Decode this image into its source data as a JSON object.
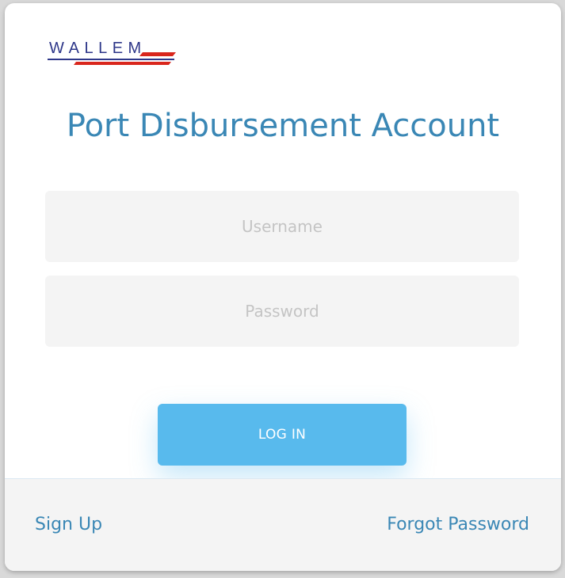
{
  "brand": {
    "logo_text": "WALLEM",
    "colors": {
      "logo_text": "#2e3789",
      "logo_stripe_red": "#d9261c",
      "logo_stripe_navy": "#2e3789"
    }
  },
  "header": {
    "title": "Port Disbursement Account"
  },
  "form": {
    "username_placeholder": "Username",
    "username_value": "",
    "password_placeholder": "Password",
    "password_value": "",
    "login_label": "LOG IN"
  },
  "footer": {
    "signup_label": "Sign Up",
    "forgot_label": "Forgot Password"
  },
  "theme": {
    "accent": "#3a87b5",
    "button": "#58baed",
    "field_bg": "#f4f4f4"
  }
}
